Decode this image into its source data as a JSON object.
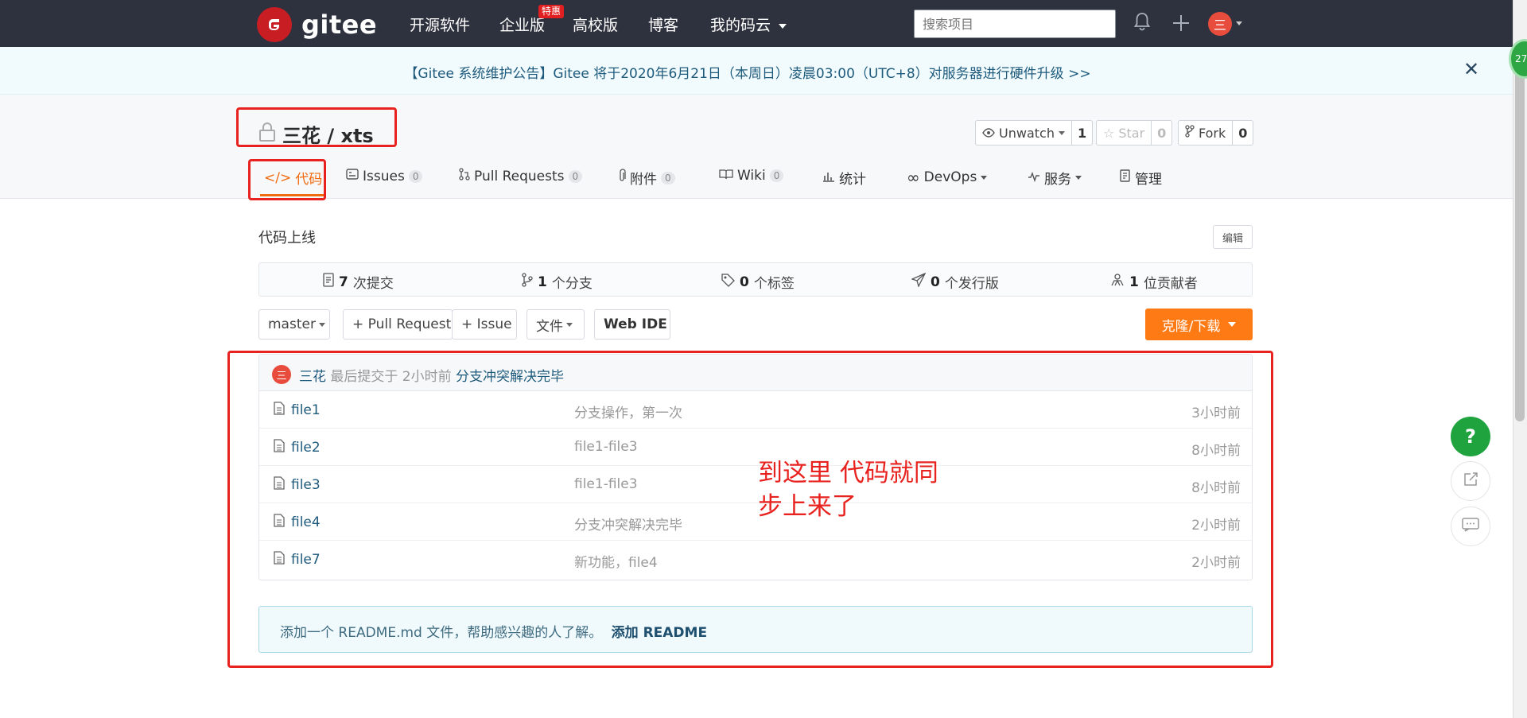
{
  "topnav": {
    "brand": "gitee",
    "items": [
      "开源软件",
      "企业版",
      "高校版",
      "博客",
      "我的码云"
    ],
    "hot_badge": "特惠",
    "search_placeholder": "搜索项目",
    "avatar_char": "三"
  },
  "notice": {
    "text": "【Gitee 系统维护公告】Gitee 将于2020年6月21日（本周日）凌晨03:00（UTC+8）对服务器进行硬件升级 >>"
  },
  "repo": {
    "title": "三花 / xts",
    "watch": {
      "label": "Unwatch",
      "count": "1"
    },
    "star": {
      "label": "Star",
      "count": "0"
    },
    "fork": {
      "label": "Fork",
      "count": "0"
    }
  },
  "tabs": [
    {
      "label": "代码"
    },
    {
      "label": "Issues",
      "badge": "0"
    },
    {
      "label": "Pull Requests",
      "badge": "0"
    },
    {
      "label": "附件",
      "badge": "0"
    },
    {
      "label": "Wiki",
      "badge": "0"
    },
    {
      "label": "统计"
    },
    {
      "label": "DevOps"
    },
    {
      "label": "服务"
    },
    {
      "label": "管理"
    }
  ],
  "description": "代码上线",
  "edit_label": "编辑",
  "stats": [
    {
      "num": "7",
      "label": "次提交"
    },
    {
      "num": "1",
      "label": "个分支"
    },
    {
      "num": "0",
      "label": "个标签"
    },
    {
      "num": "0",
      "label": "个发行版"
    },
    {
      "num": "1",
      "label": "位贡献者"
    }
  ],
  "controls": {
    "branch": "master",
    "pull_request": "+ Pull Request",
    "issue": "+ Issue",
    "files": "文件",
    "web_ide": "Web IDE",
    "clone": "克隆/下载"
  },
  "last_commit": {
    "avatar_char": "三",
    "author": "三花",
    "meta": "最后提交于 2小时前",
    "message": "分支冲突解决完毕"
  },
  "files": [
    {
      "name": "file1",
      "message": "分支操作，第一次",
      "time": "3小时前"
    },
    {
      "name": "file2",
      "message": "file1-file3",
      "time": "8小时前"
    },
    {
      "name": "file3",
      "message": "file1-file3",
      "time": "8小时前"
    },
    {
      "name": "file4",
      "message": "分支冲突解决完毕",
      "time": "2小时前"
    },
    {
      "name": "file7",
      "message": "新功能，file4",
      "time": "2小时前"
    }
  ],
  "readme": {
    "text": "添加一个 README.md 文件，帮助感兴趣的人了解。",
    "link": "添加 README"
  },
  "annotation": {
    "line1": "到这里 代码就同",
    "line2": "步上来了"
  },
  "help_label": "?",
  "floating_badge": "27"
}
